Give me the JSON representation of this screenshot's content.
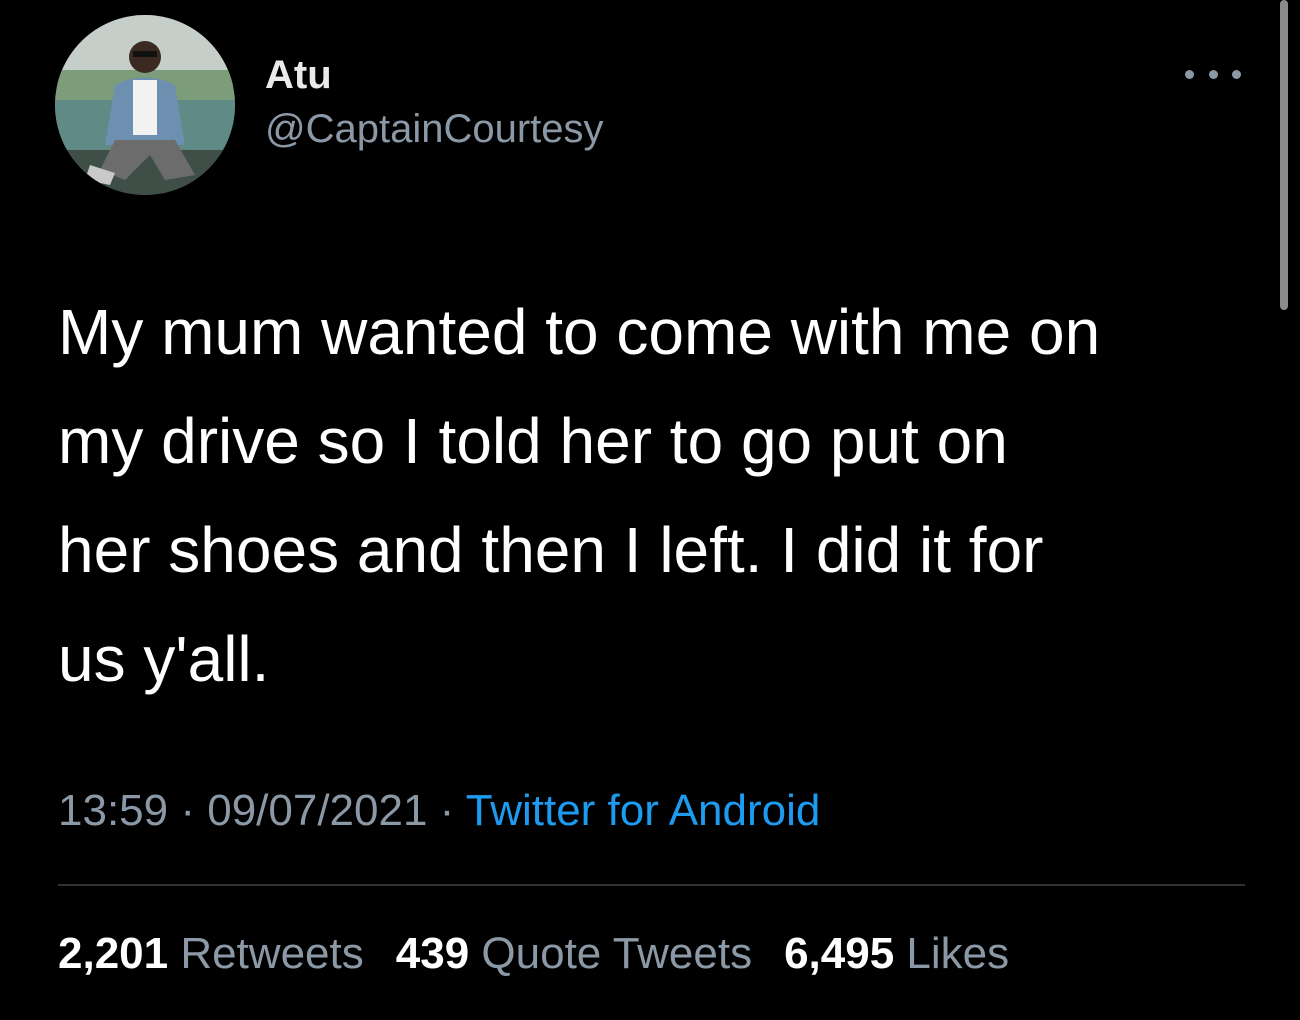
{
  "user": {
    "display_name": "Atu",
    "handle": "@CaptainCourtesy",
    "avatar_icon": "profile-photo"
  },
  "menu": {
    "more_icon": "more-horizontal-icon"
  },
  "tweet": {
    "text": "My mum wanted to come with me on\nmy drive so I told her to go put on\nher shoes and then I left. I did it for\nus y'all."
  },
  "meta": {
    "time": "13:59",
    "separator": " · ",
    "date": "09/07/2021",
    "source": "Twitter for Android"
  },
  "stats": {
    "retweets_count": "2,201",
    "retweets_label": " Retweets",
    "quotes_count": "439",
    "quotes_label": " Quote Tweets",
    "likes_count": "6,495",
    "likes_label": " Likes"
  },
  "colors": {
    "background": "#000000",
    "primary_text": "#e7e9ea",
    "secondary_text": "#8b98a5",
    "link": "#1d9bf0",
    "divider": "#2f3336"
  }
}
